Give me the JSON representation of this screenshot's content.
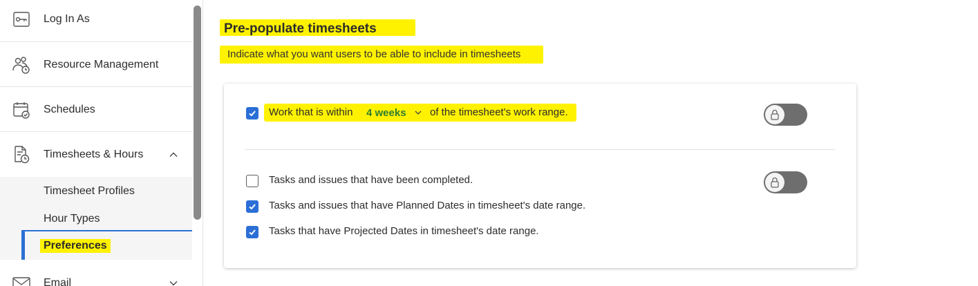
{
  "sidebar": {
    "items": [
      {
        "label": "Log In As",
        "icon": "key-icon"
      },
      {
        "label": "Resource Management",
        "icon": "people-clock-icon"
      },
      {
        "label": "Schedules",
        "icon": "calendar-check-icon"
      },
      {
        "label": "Timesheets & Hours",
        "icon": "document-clock-icon",
        "expanded": true
      },
      {
        "label": "Email",
        "icon": "mail-icon",
        "expanded": false
      }
    ],
    "submenu": [
      {
        "label": "Timesheet Profiles"
      },
      {
        "label": "Hour Types"
      },
      {
        "label": "Preferences",
        "active": true
      }
    ]
  },
  "main": {
    "title": "Pre-populate timesheets",
    "subtitle": "Indicate what you want users to be able to include in timesheets",
    "work_row": {
      "checked": true,
      "prefix": "Work that is within",
      "range_value": "4 weeks",
      "suffix": "of the timesheet's work range."
    },
    "task_rows": [
      {
        "label": "Tasks and issues that have been completed.",
        "checked": false
      },
      {
        "label": "Tasks and issues that have Planned Dates in timesheet's date range.",
        "checked": true
      },
      {
        "label": "Tasks that have Projected Dates in timesheet's date range.",
        "checked": true
      }
    ],
    "toggles": [
      {
        "state": "locked"
      },
      {
        "state": "locked"
      }
    ]
  },
  "colors": {
    "accent": "#2b6fd6",
    "highlight": "#fff200",
    "range_value": "#2e7d32",
    "toggle": "#6e6e6e"
  }
}
